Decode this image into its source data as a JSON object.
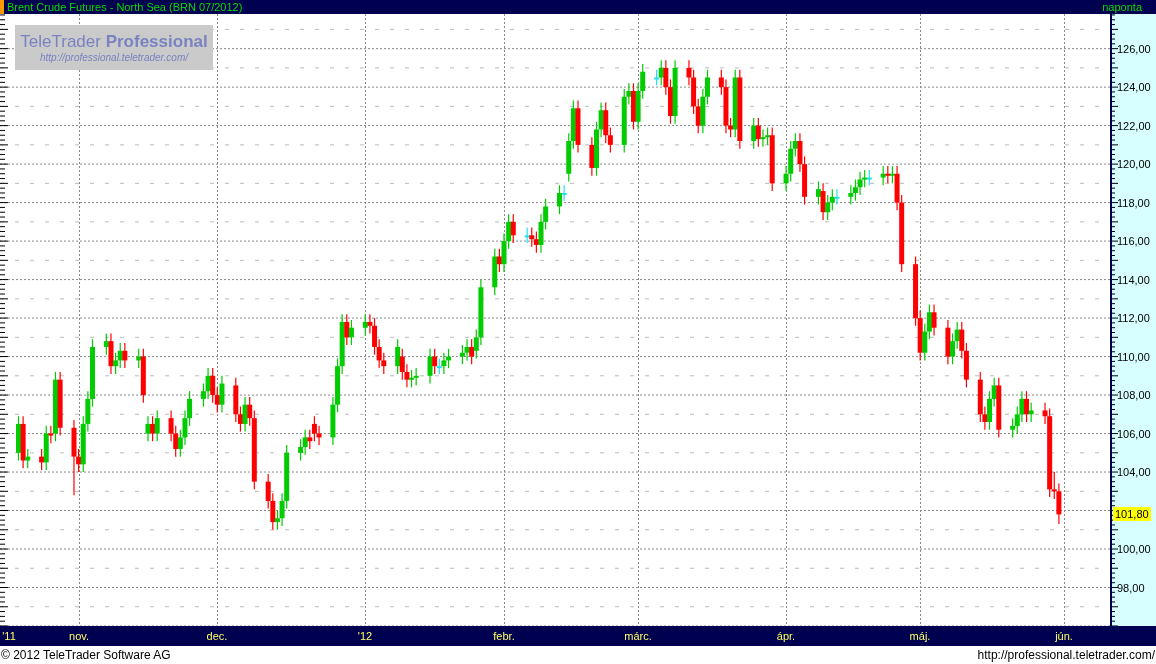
{
  "header": {
    "title": "Brent Crude Futures - North Sea (BRN 07/2012)",
    "interval": "naponta"
  },
  "logo": {
    "name": "TeleTrader **Professional**",
    "url": "http://professional.teletrader.com/"
  },
  "chart": {
    "chart_data": {
      "type": "candlestick",
      "ylim": [
        96.0,
        127.8
      ],
      "yticks": [
        {
          "value": 98,
          "label": "98,00"
        },
        {
          "value": 100,
          "label": "100,00"
        },
        {
          "value": 104,
          "label": "104,00"
        },
        {
          "value": 106,
          "label": "106,00"
        },
        {
          "value": 108,
          "label": "108,00"
        },
        {
          "value": 110,
          "label": "110,00"
        },
        {
          "value": 112,
          "label": "112,00"
        },
        {
          "value": 114,
          "label": "114,00"
        },
        {
          "value": 116,
          "label": "116,00"
        },
        {
          "value": 118,
          "label": "118,00"
        },
        {
          "value": 120,
          "label": "120,00"
        },
        {
          "value": 122,
          "label": "122,00"
        },
        {
          "value": 124,
          "label": "124,00"
        },
        {
          "value": 126,
          "label": "126,00"
        }
      ],
      "xlim": [
        "2011-10-15",
        "2012-06-21"
      ],
      "grid": true,
      "xticks": [
        {
          "value": "2011-10-17",
          "label": "'11"
        },
        {
          "value": "2011-11-01",
          "label": "nov."
        },
        {
          "value": "2011-12-01",
          "label": "dec."
        },
        {
          "value": "2012-01-02",
          "label": "'12"
        },
        {
          "value": "2012-02-01",
          "label": "febr."
        },
        {
          "value": "2012-03-01",
          "label": "márc."
        },
        {
          "value": "2012-04-02",
          "label": "ápr."
        },
        {
          "value": "2012-05-01",
          "label": "máj."
        },
        {
          "value": "2012-06-01",
          "label": "jún."
        }
      ],
      "annotations": [
        "101,80"
      ],
      "x": [
        "2011-10-19",
        "2011-10-20",
        "2011-10-21",
        "2011-10-24",
        "2011-10-25",
        "2011-10-26",
        "2011-10-27",
        "2011-10-28",
        "2011-10-31",
        "2011-11-01",
        "2011-11-02",
        "2011-11-03",
        "2011-11-04",
        "2011-11-07",
        "2011-11-08",
        "2011-11-09",
        "2011-11-10",
        "2011-11-11",
        "2011-11-14",
        "2011-11-15",
        "2011-11-16",
        "2011-11-17",
        "2011-11-18",
        "2011-11-21",
        "2011-11-22",
        "2011-11-23",
        "2011-11-24",
        "2011-11-25",
        "2011-11-28",
        "2011-11-29",
        "2011-11-30",
        "2011-12-01",
        "2011-12-02",
        "2011-12-05",
        "2011-12-06",
        "2011-12-07",
        "2011-12-08",
        "2011-12-09",
        "2011-12-12",
        "2011-12-13",
        "2011-12-14",
        "2011-12-15",
        "2011-12-16",
        "2011-12-19",
        "2011-12-20",
        "2011-12-21",
        "2011-12-22",
        "2011-12-23",
        "2011-12-26",
        "2011-12-27",
        "2011-12-28",
        "2011-12-29",
        "2011-12-30",
        "2012-01-02",
        "2012-01-03",
        "2012-01-04",
        "2012-01-05",
        "2012-01-06",
        "2012-01-09",
        "2012-01-10",
        "2012-01-11",
        "2012-01-12",
        "2012-01-13",
        "2012-01-16",
        "2012-01-17",
        "2012-01-18",
        "2012-01-19",
        "2012-01-20",
        "2012-01-23",
        "2012-01-24",
        "2012-01-25",
        "2012-01-26",
        "2012-01-27",
        "2012-01-30",
        "2012-01-31",
        "2012-02-01",
        "2012-02-02",
        "2012-02-03",
        "2012-02-06",
        "2012-02-07",
        "2012-02-08",
        "2012-02-09",
        "2012-02-10",
        "2012-02-13",
        "2012-02-14",
        "2012-02-15",
        "2012-02-16",
        "2012-02-17",
        "2012-02-20",
        "2012-02-21",
        "2012-02-22",
        "2012-02-23",
        "2012-02-24",
        "2012-02-27",
        "2012-02-28",
        "2012-02-29",
        "2012-03-01",
        "2012-03-02",
        "2012-03-05",
        "2012-03-06",
        "2012-03-07",
        "2012-03-08",
        "2012-03-09",
        "2012-03-12",
        "2012-03-13",
        "2012-03-14",
        "2012-03-15",
        "2012-03-16",
        "2012-03-19",
        "2012-03-20",
        "2012-03-21",
        "2012-03-22",
        "2012-03-23",
        "2012-03-26",
        "2012-03-27",
        "2012-03-28",
        "2012-03-29",
        "2012-03-30",
        "2012-04-02",
        "2012-04-03",
        "2012-04-04",
        "2012-04-05",
        "2012-04-06",
        "2012-04-09",
        "2012-04-10",
        "2012-04-11",
        "2012-04-12",
        "2012-04-13",
        "2012-04-16",
        "2012-04-17",
        "2012-04-18",
        "2012-04-19",
        "2012-04-20",
        "2012-04-23",
        "2012-04-24",
        "2012-04-25",
        "2012-04-26",
        "2012-04-27",
        "2012-04-30",
        "2012-05-01",
        "2012-05-02",
        "2012-05-03",
        "2012-05-04",
        "2012-05-07",
        "2012-05-08",
        "2012-05-09",
        "2012-05-10",
        "2012-05-11",
        "2012-05-14",
        "2012-05-15",
        "2012-05-16",
        "2012-05-17",
        "2012-05-18",
        "2012-05-21",
        "2012-05-22",
        "2012-05-23",
        "2012-05-24",
        "2012-05-25",
        "2012-05-28",
        "2012-05-29",
        "2012-05-30",
        "2012-05-31"
      ],
      "ohlc": [
        [
          105.0,
          106.9,
          104.6,
          106.5
        ],
        [
          106.5,
          106.9,
          104.2,
          104.6
        ],
        [
          104.6,
          105.2,
          104.2,
          104.8
        ],
        [
          104.8,
          105.2,
          104.1,
          104.5
        ],
        [
          104.5,
          106.4,
          104.1,
          106.0
        ],
        [
          106.0,
          106.4,
          105.5,
          105.9
        ],
        [
          106.0,
          109.2,
          105.6,
          108.8
        ],
        [
          108.8,
          109.2,
          105.9,
          106.3
        ],
        [
          106.3,
          106.7,
          102.8,
          104.8
        ],
        [
          104.8,
          105.2,
          104.0,
          104.4
        ],
        [
          104.4,
          106.9,
          104.0,
          106.5
        ],
        [
          106.5,
          108.2,
          106.1,
          107.8
        ],
        [
          107.8,
          110.9,
          107.4,
          110.5
        ],
        [
          110.5,
          111.2,
          110.1,
          110.8
        ],
        [
          110.8,
          111.2,
          109.1,
          109.5
        ],
        [
          109.5,
          110.2,
          109.1,
          109.8
        ],
        [
          109.8,
          110.7,
          109.4,
          110.3
        ],
        [
          110.3,
          110.7,
          109.4,
          109.8
        ],
        [
          109.8,
          110.4,
          109.4,
          110.0
        ],
        [
          110.0,
          110.4,
          107.6,
          108.0
        ],
        [
          106.0,
          106.9,
          105.6,
          106.5
        ],
        [
          106.5,
          106.9,
          105.6,
          106.0
        ],
        [
          106.0,
          107.2,
          105.6,
          106.8
        ],
        [
          106.8,
          107.2,
          105.6,
          106.0
        ],
        [
          106.0,
          106.4,
          104.8,
          105.2
        ],
        [
          105.2,
          106.2,
          104.8,
          105.8
        ],
        [
          105.8,
          107.2,
          105.4,
          106.8
        ],
        [
          106.8,
          108.2,
          106.4,
          107.8
        ],
        [
          107.8,
          108.6,
          107.4,
          108.2
        ],
        [
          108.2,
          109.4,
          107.8,
          109.0
        ],
        [
          109.0,
          109.4,
          107.6,
          108.0
        ],
        [
          108.0,
          108.4,
          107.1,
          107.5
        ],
        [
          107.5,
          109.0,
          107.1,
          108.6
        ],
        [
          108.5,
          108.9,
          106.6,
          107.0
        ],
        [
          107.0,
          107.4,
          106.1,
          106.5
        ],
        [
          106.5,
          107.9,
          106.1,
          107.5
        ],
        [
          107.5,
          107.9,
          106.4,
          106.8
        ],
        [
          106.8,
          107.2,
          103.1,
          103.5
        ],
        [
          103.5,
          103.9,
          102.1,
          102.5
        ],
        [
          102.5,
          102.9,
          101.0,
          101.4
        ],
        [
          101.4,
          102.0,
          101.0,
          101.6
        ],
        [
          101.6,
          102.9,
          101.2,
          102.5
        ],
        [
          102.5,
          105.4,
          102.1,
          105.0
        ],
        [
          105.0,
          105.7,
          104.6,
          105.3
        ],
        [
          105.3,
          106.2,
          104.9,
          105.8
        ],
        [
          105.8,
          106.2,
          105.2,
          105.6
        ],
        [
          106.5,
          106.9,
          105.6,
          106.0
        ],
        [
          106.0,
          106.4,
          105.4,
          105.8
        ],
        [
          105.8,
          107.9,
          105.4,
          107.5
        ],
        [
          107.5,
          109.9,
          107.1,
          109.5
        ],
        [
          109.5,
          112.2,
          109.1,
          111.8
        ],
        [
          111.8,
          112.2,
          110.6,
          111.0
        ],
        [
          111.0,
          111.9,
          110.6,
          111.5
        ],
        [
          111.5,
          112.2,
          111.1,
          111.8
        ],
        [
          111.8,
          112.2,
          111.2,
          111.6
        ],
        [
          111.6,
          112.0,
          110.1,
          110.5
        ],
        [
          110.5,
          110.9,
          109.4,
          109.8
        ],
        [
          109.8,
          110.2,
          109.1,
          109.5
        ],
        [
          109.5,
          110.9,
          109.1,
          110.5
        ],
        [
          110.0,
          110.4,
          108.8,
          109.2
        ],
        [
          109.2,
          109.6,
          108.4,
          108.8
        ],
        [
          108.8,
          109.3,
          108.4,
          108.9
        ],
        [
          108.9,
          109.4,
          108.5,
          109.0
        ],
        [
          109.0,
          110.4,
          108.6,
          110.0
        ],
        [
          110.0,
          110.4,
          109.1,
          109.5
        ],
        [
          109.5,
          109.9,
          109.1,
          109.5
        ],
        [
          109.5,
          110.2,
          109.1,
          109.8
        ],
        [
          109.8,
          110.4,
          109.4,
          110.0
        ],
        [
          110.0,
          110.6,
          109.6,
          110.2
        ],
        [
          110.2,
          110.9,
          109.8,
          110.5
        ],
        [
          110.5,
          110.9,
          109.6,
          110.0
        ],
        [
          110.3,
          111.4,
          109.9,
          111.0
        ],
        [
          111.0,
          114.0,
          110.6,
          113.6
        ],
        [
          113.6,
          115.6,
          113.2,
          115.2
        ],
        [
          115.2,
          115.6,
          114.4,
          114.8
        ],
        [
          114.8,
          116.4,
          114.4,
          116.0
        ],
        [
          116.0,
          117.4,
          115.6,
          117.0
        ],
        [
          117.0,
          117.4,
          115.9,
          116.3
        ],
        [
          116.3,
          116.7,
          115.9,
          116.3
        ],
        [
          116.3,
          116.7,
          115.7,
          116.1
        ],
        [
          116.1,
          116.5,
          115.4,
          115.8
        ],
        [
          115.8,
          117.4,
          115.4,
          117.0
        ],
        [
          117.0,
          118.2,
          116.6,
          117.8
        ],
        [
          117.8,
          118.9,
          117.4,
          118.5
        ],
        [
          118.5,
          118.9,
          118.1,
          118.5
        ],
        [
          119.5,
          121.6,
          119.1,
          121.2
        ],
        [
          121.2,
          123.3,
          120.8,
          122.9
        ],
        [
          122.9,
          123.3,
          120.6,
          121.0
        ],
        [
          121.0,
          121.4,
          119.4,
          119.8
        ],
        [
          119.8,
          122.2,
          119.4,
          121.8
        ],
        [
          121.8,
          123.2,
          121.4,
          122.8
        ],
        [
          122.8,
          123.2,
          121.1,
          121.5
        ],
        [
          121.5,
          121.9,
          120.6,
          121.0
        ],
        [
          121.0,
          123.9,
          120.6,
          123.5
        ],
        [
          123.5,
          124.2,
          123.1,
          123.8
        ],
        [
          123.8,
          124.2,
          121.8,
          122.2
        ],
        [
          122.2,
          124.2,
          121.8,
          123.8
        ],
        [
          123.8,
          125.2,
          123.4,
          124.8
        ],
        [
          124.5,
          124.9,
          124.1,
          124.5
        ],
        [
          124.5,
          125.4,
          124.1,
          125.0
        ],
        [
          125.0,
          125.4,
          123.6,
          124.0
        ],
        [
          124.0,
          124.4,
          122.1,
          122.5
        ],
        [
          122.5,
          125.4,
          122.1,
          125.0
        ],
        [
          125.0,
          125.4,
          124.1,
          124.5
        ],
        [
          124.5,
          124.9,
          122.6,
          123.0
        ],
        [
          123.0,
          123.4,
          121.6,
          122.0
        ],
        [
          122.0,
          123.9,
          121.6,
          123.5
        ],
        [
          123.5,
          124.9,
          123.1,
          124.5
        ],
        [
          124.5,
          124.9,
          123.6,
          124.0
        ],
        [
          124.0,
          124.4,
          121.6,
          122.0
        ],
        [
          122.0,
          122.4,
          121.4,
          121.8
        ],
        [
          121.8,
          124.9,
          121.4,
          124.5
        ],
        [
          124.5,
          124.9,
          120.8,
          121.2
        ],
        [
          121.2,
          122.4,
          120.8,
          122.0
        ],
        [
          122.0,
          122.4,
          120.9,
          121.3
        ],
        [
          121.3,
          121.8,
          120.9,
          121.4
        ],
        [
          121.4,
          121.9,
          121.0,
          121.5
        ],
        [
          121.5,
          121.9,
          118.6,
          119.0
        ],
        [
          119.0,
          119.9,
          118.6,
          119.5
        ],
        [
          119.5,
          121.2,
          119.1,
          120.8
        ],
        [
          120.8,
          121.6,
          120.4,
          121.2
        ],
        [
          121.2,
          121.6,
          119.6,
          120.0
        ],
        [
          120.0,
          120.4,
          117.9,
          118.3
        ],
        [
          118.3,
          119.1,
          117.9,
          118.7
        ],
        [
          118.6,
          119.0,
          117.1,
          117.5
        ],
        [
          117.5,
          118.4,
          117.1,
          118.0
        ],
        [
          118.0,
          118.7,
          117.6,
          118.3
        ],
        [
          118.3,
          118.7,
          117.9,
          118.3
        ],
        [
          118.3,
          118.9,
          117.9,
          118.5
        ],
        [
          118.5,
          119.2,
          118.1,
          118.8
        ],
        [
          118.8,
          119.6,
          118.4,
          119.2
        ],
        [
          119.2,
          119.7,
          118.8,
          119.3
        ],
        [
          119.3,
          119.7,
          118.9,
          119.3
        ],
        [
          119.3,
          119.9,
          118.9,
          119.5
        ],
        [
          119.5,
          119.9,
          119.0,
          119.4
        ],
        [
          119.4,
          119.9,
          119.0,
          119.5
        ],
        [
          119.5,
          119.9,
          117.6,
          118.0
        ],
        [
          118.0,
          118.4,
          114.4,
          114.8
        ],
        [
          114.8,
          115.2,
          111.6,
          112.0
        ],
        [
          112.0,
          112.4,
          109.8,
          110.2
        ],
        [
          110.2,
          111.7,
          109.8,
          111.3
        ],
        [
          111.3,
          112.7,
          110.9,
          112.3
        ],
        [
          112.3,
          112.7,
          111.1,
          111.5
        ],
        [
          111.5,
          111.9,
          109.6,
          110.0
        ],
        [
          110.0,
          111.2,
          109.6,
          110.8
        ],
        [
          110.8,
          111.8,
          110.4,
          111.4
        ],
        [
          111.4,
          111.8,
          109.9,
          110.3
        ],
        [
          110.3,
          110.7,
          108.4,
          108.8
        ],
        [
          108.8,
          109.2,
          106.6,
          107.0
        ],
        [
          107.0,
          107.4,
          106.2,
          106.6
        ],
        [
          106.6,
          108.2,
          106.2,
          107.8
        ],
        [
          107.8,
          108.9,
          107.4,
          108.5
        ],
        [
          108.5,
          108.9,
          105.8,
          106.2
        ],
        [
          106.2,
          106.8,
          105.8,
          106.4
        ],
        [
          106.4,
          107.4,
          106.0,
          107.0
        ],
        [
          107.0,
          108.2,
          106.6,
          107.8
        ],
        [
          107.8,
          108.2,
          106.6,
          107.0
        ],
        [
          107.0,
          107.6,
          106.6,
          107.2
        ],
        [
          107.2,
          107.6,
          106.5,
          106.9
        ],
        [
          106.9,
          107.3,
          102.7,
          103.1
        ],
        [
          103.1,
          104.0,
          102.6,
          103.0
        ],
        [
          103.0,
          103.4,
          101.3,
          101.8
        ]
      ]
    }
  },
  "footer": {
    "copyright": "© 2012 TeleTrader Software AG",
    "url": "http://professional.teletrader.com/"
  }
}
